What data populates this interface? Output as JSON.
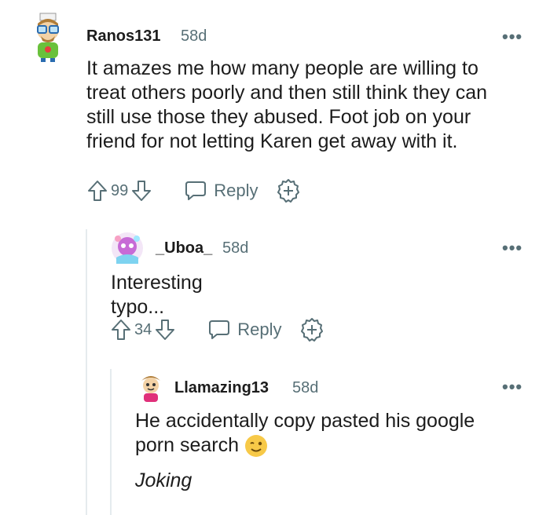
{
  "comments": [
    {
      "username": "Ranos131",
      "age": "58d",
      "body": [
        "It amazes me how many people are willing to",
        "treat others poorly and then still think they can",
        "still use those they abused. Foot job on your",
        "friend for not letting Karen get away with it."
      ],
      "score": "99",
      "reply_label": "Reply"
    },
    {
      "username": "_Uboa_",
      "age": "58d",
      "body": [
        "Interesting typo..."
      ],
      "score": "34",
      "reply_label": "Reply"
    },
    {
      "username": "Llamazing13",
      "age": "58d",
      "body": [
        "He accidentally copy pasted his google",
        "porn search"
      ],
      "emoji": "wink-emoji",
      "extra": "Joking"
    }
  ],
  "more_label": "•••",
  "colors": {
    "meta": "#576f76",
    "text": "#1c1c1c",
    "thread": "#e5ebee",
    "emoji": "#f7c948"
  }
}
